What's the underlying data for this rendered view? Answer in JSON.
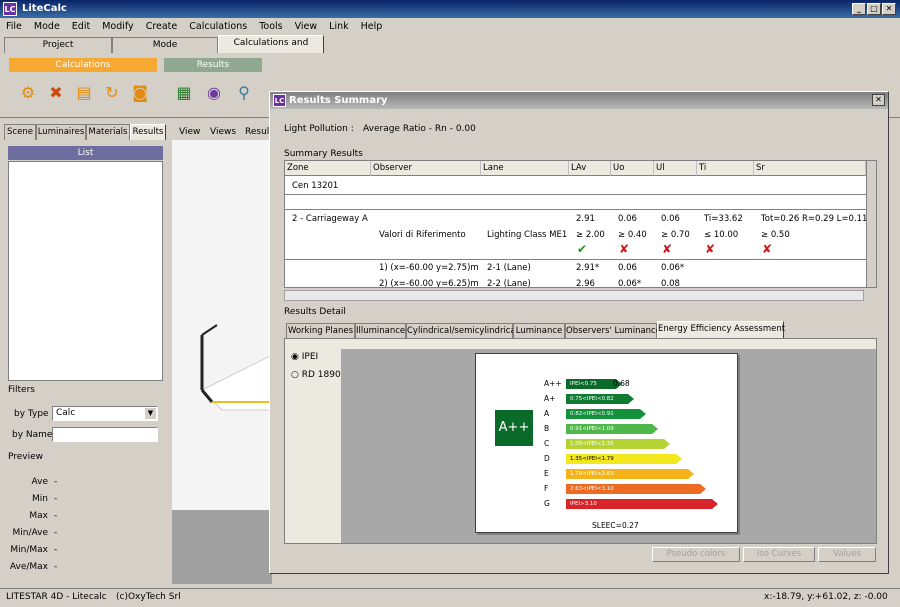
{
  "app": {
    "title": "LiteCalc",
    "logo": "LC"
  },
  "menu": [
    "File",
    "Mode",
    "Edit",
    "Modify",
    "Create",
    "Calculations",
    "Tools",
    "View",
    "Link",
    "Help"
  ],
  "top_tabs": [
    "Project",
    "Mode",
    "Calculations and Results"
  ],
  "ribbon": {
    "calc_label": "Calculations",
    "results_label": "Results",
    "calc_color": "#f7a830",
    "results_color": "#8fa88f"
  },
  "left": {
    "tabs": [
      "Scene",
      "Luminaires",
      "Materials",
      "Results"
    ],
    "list_header": "List",
    "filters_label": "Filters",
    "by_type_label": "by Type",
    "by_type_value": "Calc",
    "by_name_label": "by Name",
    "preview_label": "Preview",
    "preview_rows": [
      {
        "k": "Ave",
        "v": "-"
      },
      {
        "k": "Min",
        "v": "-"
      },
      {
        "k": "Max",
        "v": "-"
      },
      {
        "k": "Min/Ave",
        "v": "-"
      },
      {
        "k": "Min/Max",
        "v": "-"
      },
      {
        "k": "Ave/Max",
        "v": "-"
      }
    ]
  },
  "view3d": {
    "tabs": [
      "View",
      "Views",
      "Resul"
    ]
  },
  "results": {
    "logo": "LC",
    "title": "Results Summary",
    "light_pollution_label": "Light Pollution :",
    "light_pollution_value": "Average Ratio - Rn -  0.00",
    "summary_label": "Summary Results",
    "columns": [
      "Zone",
      "Observer",
      "Lane",
      "LAv",
      "Uo",
      "Ul",
      "Ti",
      "Sr"
    ],
    "cen": "Cen 13201",
    "carriage": {
      "zone": "2 - Carriageway A",
      "lav": "2.91",
      "uo": "0.06",
      "ul": "0.06",
      "ti": "Ti=33.62",
      "sr": "Tot=0.26 R=0.29 L=0.11"
    },
    "ref": {
      "observer": "Valori di Riferimento",
      "lane": "Lighting Class ME1",
      "lav": "≥ 2.00",
      "uo": "≥ 0.40",
      "ul": "≥ 0.70",
      "ti": "≤ 10.00",
      "sr": "≥ 0.50"
    },
    "marks": {
      "lav": "✔",
      "uo": "✘",
      "ul": "✘",
      "ti": "✘",
      "sr": "✘"
    },
    "obs_rows": [
      {
        "observer": "1) (x=-60.00 y=2.75)m",
        "lane": "2-1 (Lane)",
        "lav": "2.91*",
        "uo": "0.06",
        "ul": "0.06*"
      },
      {
        "observer": "2) (x=-60.00 y=6.25)m",
        "lane": "2-2 (Lane)",
        "lav": "2.96",
        "uo": "0.06*",
        "ul": "0.08"
      }
    ],
    "detail_label": "Results Detail",
    "detail_tabs": [
      "Working Planes",
      "Illuminance",
      "Cylindrical/semicylindrical",
      "Luminance",
      "Observers' Luminance",
      "Energy Efficiency Assessment"
    ],
    "radio": [
      {
        "label": "IPEI",
        "checked": true
      },
      {
        "label": "RD 1890",
        "checked": false
      }
    ],
    "energy": {
      "badge": "A++",
      "value_label": "0.68",
      "sleec": "SLEEC=0.27",
      "classes": [
        {
          "cls": "A++",
          "range": "IPEI<0.75",
          "color": "#0a6a2a"
        },
        {
          "cls": "A+",
          "range": "0.75<IPEI<0.82",
          "color": "#0e7a32"
        },
        {
          "cls": "A",
          "range": "0.82<IPEI<0.91",
          "color": "#14913b"
        },
        {
          "cls": "B",
          "range": "0.91<IPEI<1.09",
          "color": "#4fb84a"
        },
        {
          "cls": "C",
          "range": "1.09<IPEI<1.35",
          "color": "#b6d334"
        },
        {
          "cls": "D",
          "range": "1.35<IPEI<1.79",
          "color": "#f3e81e"
        },
        {
          "cls": "E",
          "range": "1.79<IPEI<2.63",
          "color": "#f6b219"
        },
        {
          "cls": "F",
          "range": "2.63<IPEI<3.10",
          "color": "#ed6a23"
        },
        {
          "cls": "G",
          "range": "IPEI>3.10",
          "color": "#d9232b"
        }
      ]
    },
    "buttons": [
      "Pseudo colors",
      "Iso Curves",
      "Values"
    ]
  },
  "status": {
    "left": "LITESTAR 4D - Litecalc",
    "mid": "(c)OxyTech Srl",
    "coords": "x:-18.79, y:+61.02, z: -0.00"
  }
}
